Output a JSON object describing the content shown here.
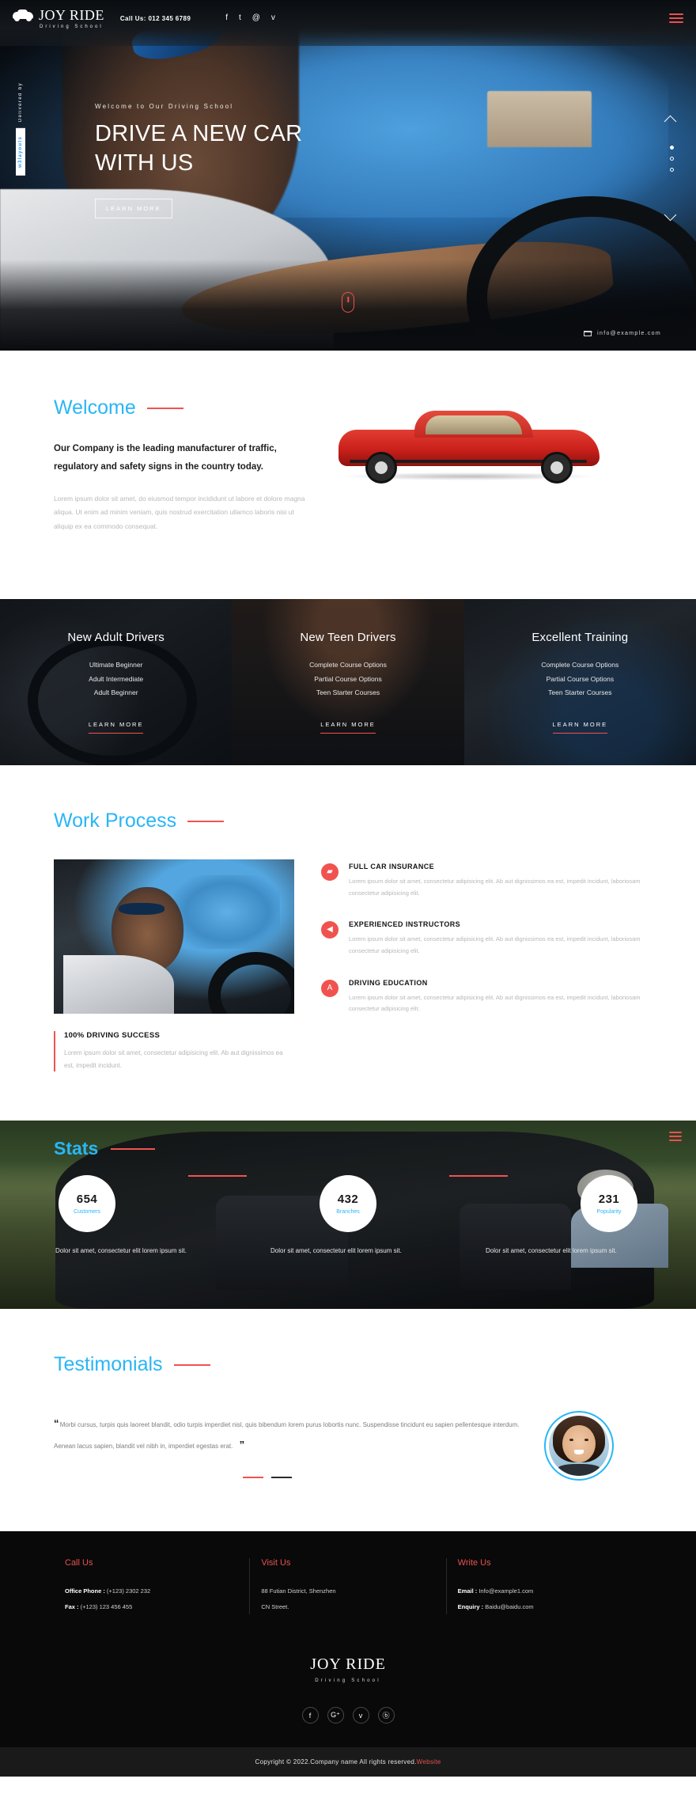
{
  "header": {
    "logo_name": "JOY RIDE",
    "logo_sub": "Driving School",
    "call_us": "Call Us: 012 345 6789",
    "socials": [
      "f",
      "t",
      "@",
      "v"
    ],
    "menu_icon": "hamburger-menu-icon"
  },
  "hero": {
    "side_by": "Delivered by",
    "side_brand": "w3layouts",
    "kicker": "Welcome to Our Driving School",
    "title_line1": "DRIVE A NEW CAR",
    "title_line2": "WITH US",
    "button": "LEARN MORE",
    "email": "info@example.com"
  },
  "welcome": {
    "title": "Welcome",
    "lead": "Our Company is the leading manufacturer of traffic, regulatory and safety signs in the country today.",
    "body": "Lorem ipsum dolor sit amet, do eiusmod tempor incididunt ut labore et dolore magna aliqua. Ut enim ad minim veniam, quis nostrud exercitation ullamco laboris nisi ut aliquip ex ea commodo consequat."
  },
  "cards": [
    {
      "title": "New Adult Drivers",
      "items": [
        "Ultimate Beginner",
        "Adult Intermediate",
        "Adult Beginner"
      ],
      "button": "LEARN MORE"
    },
    {
      "title": "New Teen Drivers",
      "items": [
        "Complete Course Options",
        "Partial Course Options",
        "Teen Starter Courses"
      ],
      "button": "LEARN MORE"
    },
    {
      "title": "Excellent Training",
      "items": [
        "Complete Course Options",
        "Partial Course Options",
        "Teen Starter Courses"
      ],
      "button": "LEARN MORE"
    }
  ],
  "work": {
    "title": "Work Process",
    "success_title": "100% DRIVING SUCCESS",
    "success_text": "Lorem ipsum dolor sit amet, consectetur adipisicing elit. Ab aut dignissimos ea est, impedit incidunt.",
    "features": [
      {
        "icon": "car-icon",
        "glyph": "▰",
        "title": "FULL CAR INSURANCE",
        "text": "Lorem ipsum dolor sit amet, consectetur adipisicing elit. Ab aut dignissimos ea est, impedit incidunt, laboriosam consectetur adipisicing elit."
      },
      {
        "icon": "megaphone-icon",
        "glyph": "◀",
        "title": "EXPERIENCED INSTRUCTORS",
        "text": "Lorem ipsum dolor sit amet, consectetur adipisicing elit. Ab aut dignissimos ea est, impedit incidunt, laboriosam consectetur adipisicing elit."
      },
      {
        "icon": "road-icon",
        "glyph": "A",
        "title": "DRIVING EDUCATION",
        "text": "Lorem ipsum dolor sit amet, consectetur adipisicing elit. Ab aut dignissimos ea est, impedit incidunt, laboriosam consectetur adipisicing elit."
      }
    ]
  },
  "stats": {
    "title": "Stats",
    "items": [
      {
        "value": "654",
        "label": "Customers",
        "note": "Dolor sit amet, consectetur elit lorem ipsum sit."
      },
      {
        "value": "432",
        "label": "Branches",
        "note": "Dolor sit amet, consectetur elit lorem ipsum sit."
      },
      {
        "value": "231",
        "label": "Popularity",
        "note": "Dolor sit amet, consectetur elit lorem ipsum sit."
      }
    ]
  },
  "testimonials": {
    "title": "Testimonials",
    "quote": "Morbi cursus, turpis quis laoreet blandit, odio turpis imperdiet nisl, quis bibendum lorem purus lobortis nunc. Suspendisse tincidunt eu sapien pellentesque interdum. Aenean lacus sapien, blandit vel nibh in, imperdiet egestas erat.",
    "quote_open": "“",
    "quote_close": "”",
    "avatar": "testimonial-avatar"
  },
  "footer": {
    "columns": [
      {
        "heading": "Call Us",
        "lines": [
          {
            "label": "Office Phone : ",
            "value": "(+123) 2302 232"
          },
          {
            "label": "Fax : ",
            "value": "(+123) 123 456 455"
          }
        ]
      },
      {
        "heading": "Visit Us",
        "lines": [
          {
            "label": "",
            "value": "88 Futian District, Shenzhen"
          },
          {
            "label": "",
            "value": "CN Street."
          }
        ]
      },
      {
        "heading": "Write Us",
        "lines": [
          {
            "label": "Email : ",
            "value": "Info@example1.com"
          },
          {
            "label": "Enquiry : ",
            "value": "Baidu@baidu.com"
          }
        ]
      }
    ],
    "logo_name": "JOY RIDE",
    "logo_sub": "Driving School",
    "socials": [
      {
        "name": "facebook-icon",
        "glyph": "f"
      },
      {
        "name": "google-plus-icon",
        "glyph": "G⁺"
      },
      {
        "name": "twitter-icon",
        "glyph": "ᴠ"
      },
      {
        "name": "dribbble-icon",
        "glyph": "ⓑ"
      }
    ],
    "copyright": "Copyright © 2022.Company name All rights reserved.",
    "copyright_link": "Website"
  },
  "colors": {
    "accent_blue": "#29b6f6",
    "accent_red": "#f0534f",
    "dark": "#090909"
  }
}
